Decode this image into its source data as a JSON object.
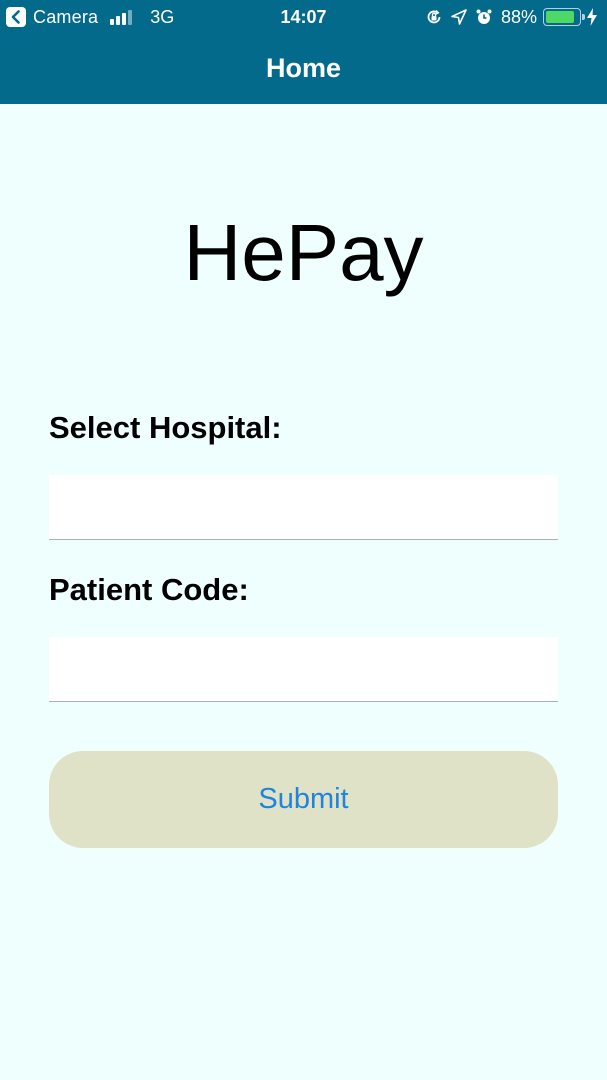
{
  "status_bar": {
    "back_app": "Camera",
    "network": "3G",
    "time": "14:07",
    "battery_percent": "88%",
    "battery_level": 0.88,
    "icons": [
      "back-arrow-icon",
      "signal-bars-icon",
      "orientation-lock-icon",
      "location-arrow-icon",
      "alarm-clock-icon",
      "battery-icon",
      "charging-bolt-icon"
    ]
  },
  "nav": {
    "title": "Home"
  },
  "app": {
    "title": "HePay"
  },
  "form": {
    "hospital_label": "Select Hospital:",
    "hospital_value": "",
    "patient_code_label": "Patient Code:",
    "patient_code_value": "",
    "submit_label": "Submit"
  },
  "colors": {
    "header": "#046a8c",
    "background": "#effffe",
    "button_bg": "#e0e2c7",
    "button_text": "#1e84dd",
    "battery_fill": "#4cd964"
  }
}
